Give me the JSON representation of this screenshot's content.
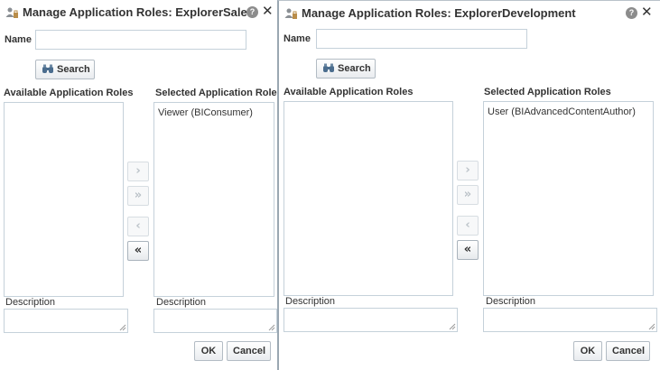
{
  "dialogs": [
    {
      "title": "Manage Application Roles: ExplorerSales",
      "name_label": "Name",
      "name_value": "",
      "search_label": "Search",
      "available_label": "Available Application Roles",
      "selected_label": "Selected Application Roles",
      "available_items": [],
      "selected_items": [
        "Viewer (BIConsumer)"
      ],
      "description_label": "Description",
      "ok_label": "OK",
      "cancel_label": "Cancel",
      "help_glyph": "?",
      "close_glyph": "✕"
    },
    {
      "title": "Manage Application Roles: ExplorerDevelopment",
      "name_label": "Name",
      "name_value": "",
      "search_label": "Search",
      "available_label": "Available Application Roles",
      "selected_label": "Selected Application Roles",
      "available_items": [],
      "selected_items": [
        "User (BIAdvancedContentAuthor)"
      ],
      "description_label": "Description",
      "ok_label": "OK",
      "cancel_label": "Cancel",
      "help_glyph": "?",
      "close_glyph": "✕"
    }
  ],
  "shuttle_glyphs": {
    "move": "›",
    "move_all": "»",
    "remove": "‹",
    "remove_all": "«"
  },
  "icons": {
    "title": "app-roles-icon",
    "search": "binoculars-icon",
    "help": "help-icon",
    "close": "close-icon"
  },
  "colors": {
    "border": "#c5d1da",
    "text": "#333333"
  }
}
